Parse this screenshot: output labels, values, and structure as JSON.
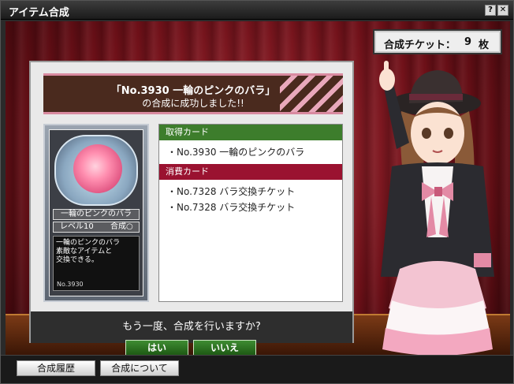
{
  "window": {
    "title": "アイテム合成",
    "help_label": "?",
    "close_label": "✕"
  },
  "ticket": {
    "label": "合成チケット：",
    "count": "9",
    "unit": "枚"
  },
  "banner": {
    "line1": "「No.3930 一輪のピンクのバラ」",
    "line2": "の合成に成功しました!!"
  },
  "card": {
    "name": "一輪のピンクのバラ",
    "level": "レベル10",
    "synth": "合成○",
    "description": [
      "一輪のピンクのバラ",
      "素敵なアイテムと",
      "交換できる。"
    ],
    "number": "No.3930"
  },
  "results": {
    "acquired_header": "取得カード",
    "acquired_items": [
      "・No.3930 一輪のピンクのバラ"
    ],
    "consumed_header": "消費カード",
    "consumed_items": [
      "・No.7328 バラ交換チケット",
      "・No.7328 バラ交換チケット"
    ]
  },
  "confirm": {
    "question": "もう一度、合成を行いますか?",
    "yes_label": "はい",
    "no_label": "いいえ"
  },
  "bottom": {
    "history_label": "合成履歴",
    "about_label": "合成について"
  }
}
